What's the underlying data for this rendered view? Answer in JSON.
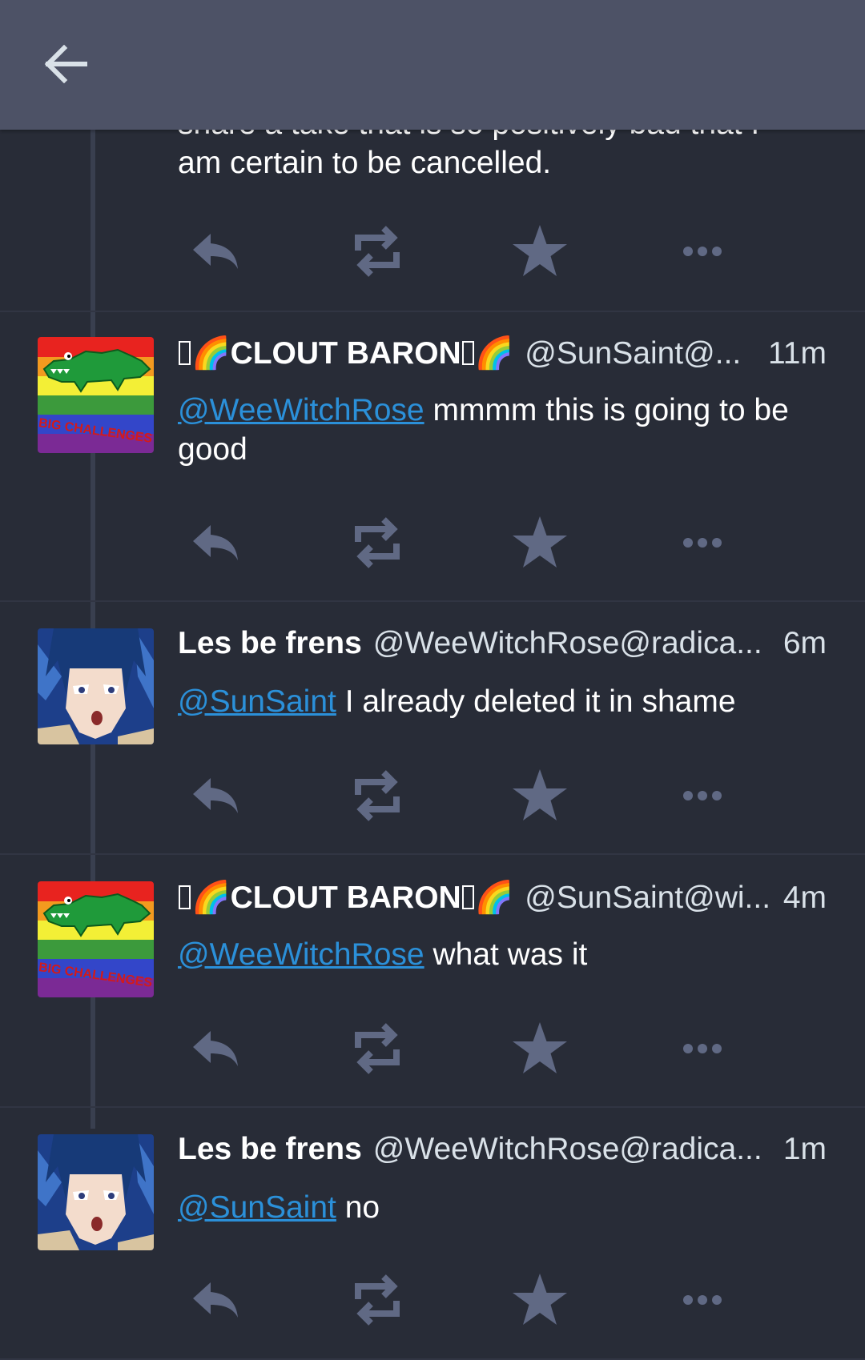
{
  "header": {
    "back_icon": "arrow-left-icon"
  },
  "partial_status": {
    "text_line1": "share a take that is so positively bad that I",
    "text_line2": "am certain to be cancelled."
  },
  "statuses": [
    {
      "display_name": "CLOUT BARON",
      "account": "@SunSaint@...",
      "time": "11m",
      "mention": "@WeeWitchRose",
      "text": " mmmm this is going to be good",
      "avatar": "rainbow-crocodile"
    },
    {
      "display_name": "Les be frens",
      "account": "@WeeWitchRose@radica...",
      "time": "6m",
      "mention": "@SunSaint",
      "text": " I already deleted it in shame",
      "avatar": "anime-character"
    },
    {
      "display_name": "CLOUT BARON",
      "account": "@SunSaint@wi...",
      "time": "4m",
      "mention": "@WeeWitchRose",
      "text": " what was it",
      "avatar": "rainbow-crocodile"
    },
    {
      "display_name": "Les be frens",
      "account": "@WeeWitchRose@radica...",
      "time": "1m",
      "mention": "@SunSaint",
      "text": " no",
      "avatar": "anime-character"
    }
  ],
  "avatar_text": "BIG CHALLENGES",
  "colors": {
    "background": "#282c37",
    "topbar": "#4d5266",
    "icon": "#606984",
    "mention": "#2b90d9"
  }
}
